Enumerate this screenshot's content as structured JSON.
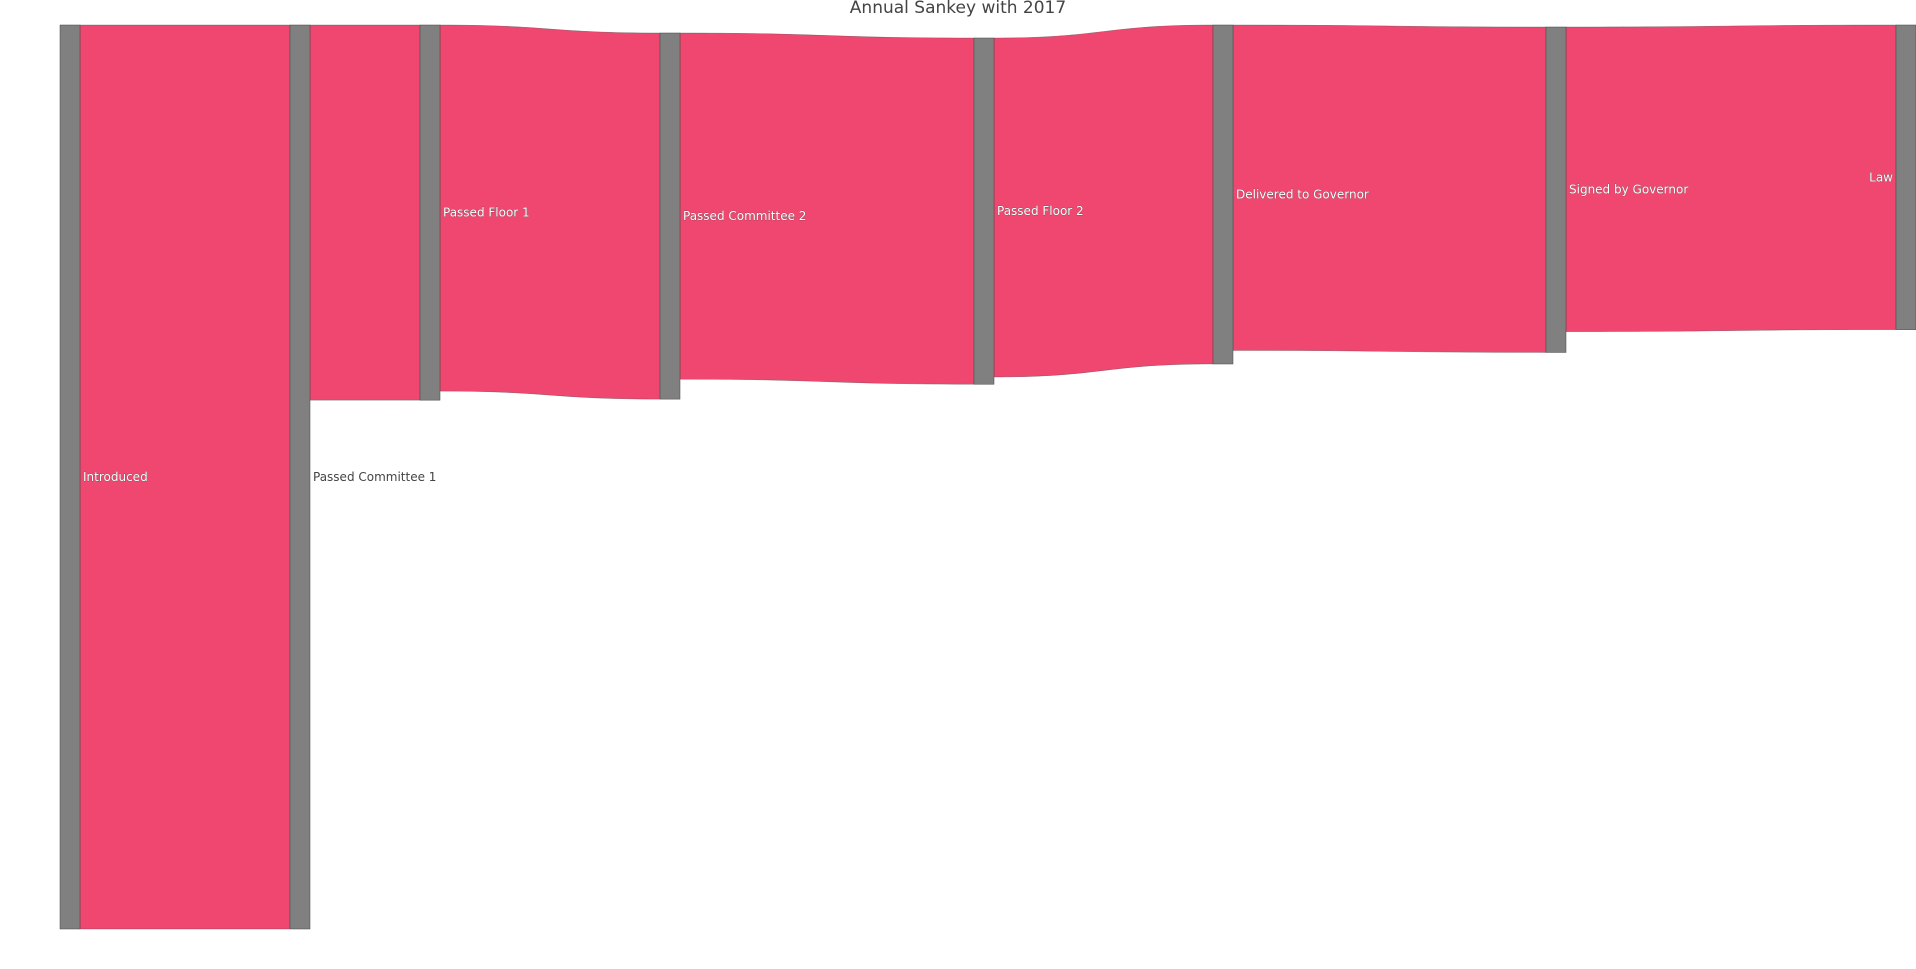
{
  "chart_data": {
    "type": "sankey",
    "title": "Annual Sankey with 2017",
    "node_color": "#808080",
    "link_color": "#ef476f",
    "label_color": "#444444",
    "nodes": [
      {
        "id": "introduced",
        "label": "Introduced"
      },
      {
        "id": "passed_committee_1",
        "label": "Passed Committee 1"
      },
      {
        "id": "passed_floor_1",
        "label": "Passed Floor 1"
      },
      {
        "id": "passed_committee_2",
        "label": "Passed Committee 2"
      },
      {
        "id": "passed_floor_2",
        "label": "Passed Floor 2"
      },
      {
        "id": "delivered_to_governor",
        "label": "Delivered to Governor"
      },
      {
        "id": "signed_by_governor",
        "label": "Signed by Governor"
      },
      {
        "id": "law",
        "label": "Law"
      }
    ],
    "links": [
      {
        "source": "introduced",
        "target": "passed_committee_1",
        "value": 1000
      },
      {
        "source": "passed_committee_1",
        "target": "passed_floor_1",
        "value": 415
      },
      {
        "source": "passed_floor_1",
        "target": "passed_committee_2",
        "value": 405
      },
      {
        "source": "passed_committee_2",
        "target": "passed_floor_2",
        "value": 383
      },
      {
        "source": "passed_floor_2",
        "target": "delivered_to_governor",
        "value": 375
      },
      {
        "source": "delivered_to_governor",
        "target": "signed_by_governor",
        "value": 360
      },
      {
        "source": "signed_by_governor",
        "target": "law",
        "value": 337
      }
    ]
  }
}
